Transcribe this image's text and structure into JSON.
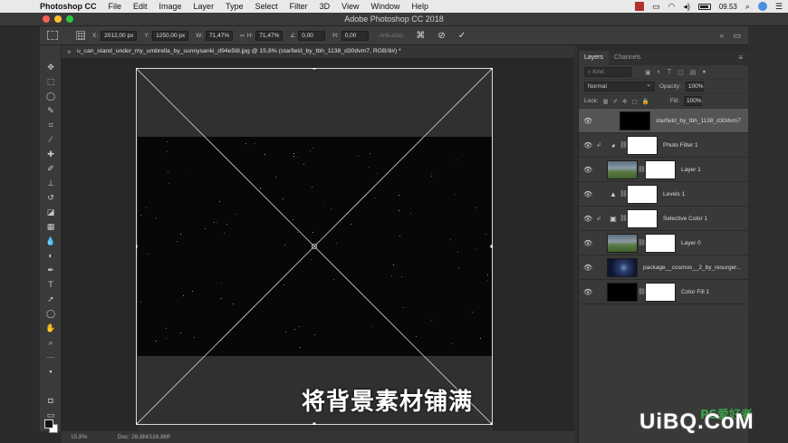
{
  "menubar": {
    "app_name": "Photoshop CC",
    "items": [
      "File",
      "Edit",
      "Image",
      "Layer",
      "Type",
      "Select",
      "Filter",
      "3D",
      "View",
      "Window",
      "Help"
    ],
    "clock": "09.53"
  },
  "titlebar": {
    "title": "Adobe Photoshop CC 2018"
  },
  "options": {
    "x_label": "X:",
    "x_value": "2012,00 px",
    "y_label": "Y:",
    "y_value": "1250,00 px",
    "w_label": "W:",
    "w_value": "71,47%",
    "h_label": "H:",
    "h_value": "71,47%",
    "angle_value": "0,00",
    "h_skew_value": "0,00",
    "antialias_label": "Anti-alias"
  },
  "document": {
    "tab_title": "u_can_stand_under_my_umbrella_by_sunnysanki_d94e5t8.jpg @ 15,8% (starfield_by_tbh_1138_d30dvm7, RGB/8#) *",
    "caption": "将背景素材铺满",
    "zoom": "15,8%",
    "doc_size": "Doc: 28,8M/116,8M"
  },
  "layers_panel": {
    "tabs": [
      "Layers",
      "Channels"
    ],
    "kind_placeholder": "Kind",
    "blend_mode": "Normal",
    "opacity_label": "Opacity:",
    "opacity_value": "100%",
    "lock_label": "Lock:",
    "fill_label": "Fill:",
    "fill_value": "100%",
    "layers": [
      {
        "name": "starfield_by_tbh_1138_d30dvm7",
        "selected": true
      },
      {
        "name": "Photo Filter 1",
        "selected": false
      },
      {
        "name": "Layer 1",
        "selected": false
      },
      {
        "name": "Levels 1",
        "selected": false
      },
      {
        "name": "Selective Color 1",
        "selected": false
      },
      {
        "name": "Layer 0",
        "selected": false
      },
      {
        "name": "package__cosmos__2_by_resurger...",
        "selected": false
      },
      {
        "name": "Color Fill 1",
        "selected": false
      }
    ]
  },
  "watermark": {
    "main": "UiBQ.CoM",
    "small": "PS爱好者"
  },
  "colors": {
    "accent_selected": "#545454",
    "canvas_bg": "#282828"
  }
}
